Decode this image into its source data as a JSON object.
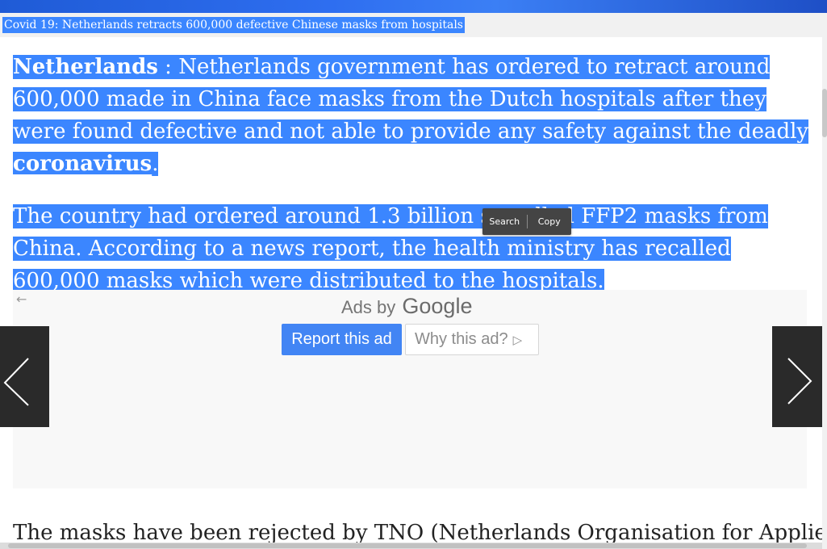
{
  "caption": "Covid 19: Netherlands retracts 600,000 defective Chinese masks from hospitals",
  "article": {
    "p1": {
      "lead": "Netherlands",
      "text": " : Netherlands government has ordered to retract around 600,000 made in China face masks from the Dutch hospitals after they were found defective and not able to provide any safety against the deadly ",
      "link": "coronavirus",
      "end": "."
    },
    "p2": {
      "text": "The country had ordered around 1.3 billion so-called FFP2 masks from China. According to a news report, the health ministry has recalled 600,000 masks which were distributed to the hospitals."
    },
    "p3": {
      "text": "The masks have been rejected by TNO (Netherlands Organisation for Applied"
    }
  },
  "context_menu": {
    "search": "Search",
    "copy": "Copy"
  },
  "ad": {
    "ads_by": "Ads by",
    "google": "Google",
    "report": "Report this ad",
    "why": "Why this ad?",
    "back_icon": "arrow-left-icon",
    "info_icon": "ad-choices-icon"
  },
  "nav": {
    "prev": "chevron-left-icon",
    "next": "chevron-right-icon"
  },
  "colors": {
    "selection": "#3b86ff",
    "nav_bg": "#2a2a2a",
    "report_button": "#4285f4",
    "toolbar_bg": "#444444",
    "top_band": "#2e6ef0"
  }
}
